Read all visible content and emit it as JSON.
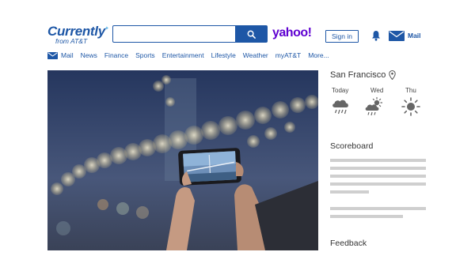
{
  "header": {
    "logo_main": "Currently",
    "logo_sub": "from AT&T",
    "search": {
      "value": "",
      "placeholder": ""
    },
    "yahoo_logo": "yahoo!",
    "signin_label": "Sign in",
    "mail_label": "Mail"
  },
  "nav": {
    "items": [
      {
        "label": "Mail",
        "icon": "mail-icon"
      },
      {
        "label": "News"
      },
      {
        "label": "Finance"
      },
      {
        "label": "Sports"
      },
      {
        "label": "Entertainment"
      },
      {
        "label": "Lifestyle"
      },
      {
        "label": "Weather"
      },
      {
        "label": "myAT&T"
      },
      {
        "label": "More..."
      }
    ]
  },
  "weather": {
    "city": "San Francisco",
    "days": [
      {
        "label": "Today",
        "icon": "rain-cloud-icon"
      },
      {
        "label": "Wed",
        "icon": "sun-cloud-rain-icon"
      },
      {
        "label": "Thu",
        "icon": "sun-icon"
      }
    ]
  },
  "sections": {
    "scoreboard": "Scoreboard",
    "feedback": "Feedback"
  },
  "colors": {
    "brand_blue": "#1e57a6",
    "yahoo_purple": "#5f01d1",
    "placeholder_gray": "#cfcfcf"
  }
}
